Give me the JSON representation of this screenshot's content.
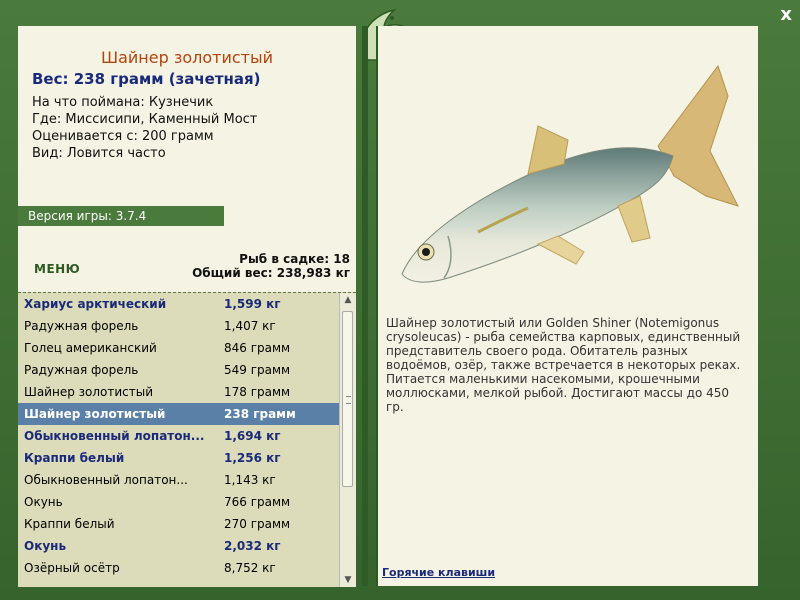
{
  "window": {
    "close_label": "x"
  },
  "details": {
    "fish_name": "Шайнер золотистый",
    "weight_line": "Вес: 238 грамм (зачетная)",
    "caught_on": "На что поймана: Кузнечик",
    "location": "Где: Миссисипи, Каменный Мост",
    "valued_from": "Оценивается с: 200 грамм",
    "frequency": "Вид: Ловится часто"
  },
  "version_label": "Версия игры: 3.7.4",
  "menu_label": "МЕНЮ",
  "keepnet": {
    "count_line": "Рыб в садке: 18",
    "total_line": "Общий вес: 238,983 кг"
  },
  "catch_list": [
    {
      "name": "Хариус арктический",
      "weight": "1,599 кг",
      "style": "bold"
    },
    {
      "name": "Радужная форель",
      "weight": "1,407 кг",
      "style": ""
    },
    {
      "name": "Голец американский",
      "weight": "846 грамм",
      "style": ""
    },
    {
      "name": "Радужная форель",
      "weight": "549 грамм",
      "style": ""
    },
    {
      "name": "Шайнер золотистый",
      "weight": "178 грамм",
      "style": ""
    },
    {
      "name": "Шайнер золотистый",
      "weight": "238 грамм",
      "style": "selected"
    },
    {
      "name": "Обыкновенный лопатон...",
      "weight": "1,694 кг",
      "style": "bold"
    },
    {
      "name": "Краппи белый",
      "weight": "1,256 кг",
      "style": "bold"
    },
    {
      "name": "Обыкновенный лопатон...",
      "weight": "1,143 кг",
      "style": ""
    },
    {
      "name": "Окунь",
      "weight": "766 грамм",
      "style": ""
    },
    {
      "name": "Краппи белый",
      "weight": "270 грамм",
      "style": ""
    },
    {
      "name": "Окунь",
      "weight": "2,032 кг",
      "style": "bold"
    },
    {
      "name": "Озёрный осётр",
      "weight": "8,752 кг",
      "style": ""
    }
  ],
  "description": "Шайнер золотистый или Golden Shiner (Notemigonus crysoleucas) - рыба семейства карповых, единственный представитель своего рода. Обитатель разных водоёмов, озёр, также встречается в некоторых реках. Питается маленькими насекомыми, крошечными моллюсками, мелкой рыбой. Достигают массы до 450 гр.",
  "hotkeys_label": "Горячие клавиши",
  "colors": {
    "accent_red": "#b3430f",
    "accent_blue": "#1a2a7a",
    "frame_green": "#4a7a3c",
    "selection": "#5a80a8"
  },
  "icons": {
    "logo": "jumping-fish-logo",
    "close": "close-icon"
  }
}
